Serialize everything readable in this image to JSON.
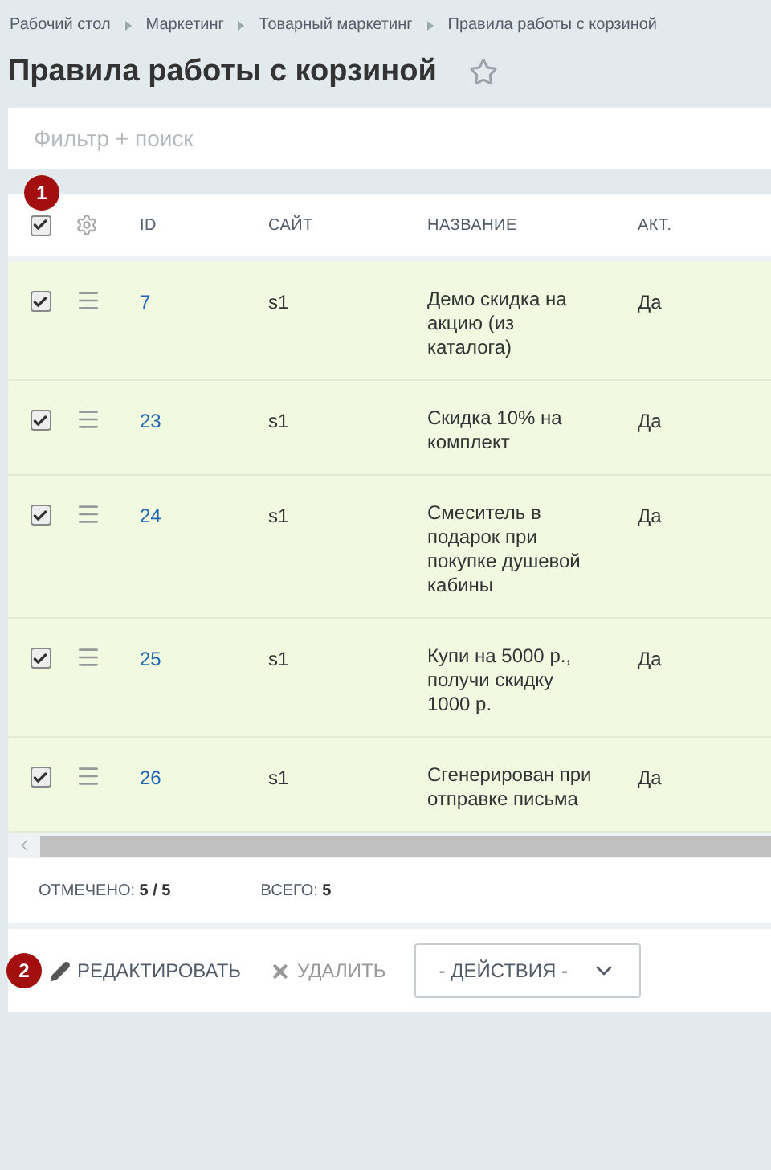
{
  "breadcrumbs": [
    "Рабочий стол",
    "Маркетинг",
    "Товарный маркетинг",
    "Правила работы с корзиной"
  ],
  "title": "Правила работы с корзиной",
  "favorite": false,
  "filter": {
    "placeholder": "Фильтр + поиск"
  },
  "markers": [
    "1",
    "2"
  ],
  "table": {
    "select_all": {
      "checked": true
    },
    "columns": [
      "ID",
      "САЙТ",
      "НАЗВАНИЕ",
      "АКТ."
    ],
    "rows": [
      {
        "selected": true,
        "cells": [
          "7",
          "s1",
          "Демо скидка на акцию (из каталога)",
          "Да"
        ]
      },
      {
        "selected": true,
        "cells": [
          "23",
          "s1",
          "Скидка 10% на комплект",
          "Да"
        ]
      },
      {
        "selected": true,
        "cells": [
          "24",
          "s1",
          "Смеситель в подарок при покупке душевой кабины",
          "Да"
        ]
      },
      {
        "selected": true,
        "cells": [
          "25",
          "s1",
          "Купи на 5000 р., получи скидку 1000 р.",
          "Да"
        ]
      },
      {
        "selected": true,
        "cells": [
          "26",
          "s1",
          "Сгенерирован при отправке письма",
          "Да"
        ]
      }
    ]
  },
  "footer": {
    "checked_label": "ОТМЕЧЕНО:",
    "checked_value": "5 / 5",
    "total_label": "ВСЕГО:",
    "total_value": "5"
  },
  "actions": {
    "edit": "РЕДАКТИРОВАТЬ",
    "delete": "УДАЛИТЬ",
    "dropdown": "- ДЕЙСТВИЯ -"
  }
}
